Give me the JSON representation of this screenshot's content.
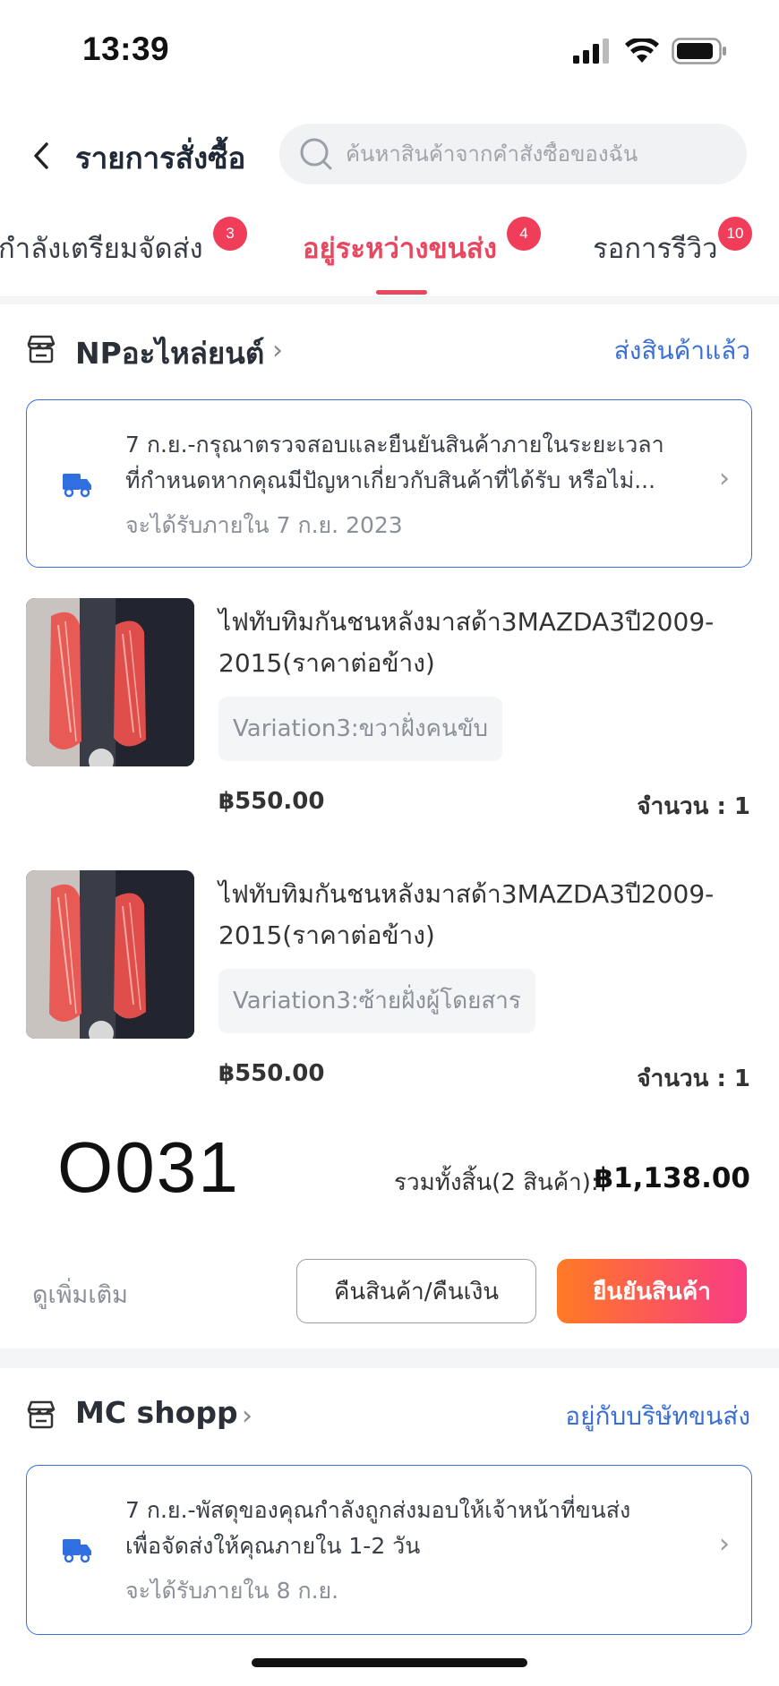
{
  "status_bar": {
    "time": "13:39"
  },
  "header": {
    "title": "รายการสั่งซื้อ",
    "search_placeholder": "ค้นหาสินค้าจากคำสั่งซื้อของฉัน"
  },
  "tabs": [
    {
      "label": "กำลังเตรียมจัดส่ง",
      "badge": "3",
      "active": false
    },
    {
      "label": "อยู่ระหว่างขนส่ง",
      "badge": "4",
      "active": true
    },
    {
      "label": "รอการรีวิว",
      "badge": "10",
      "active": false
    }
  ],
  "colors": {
    "accent": "#e8475f",
    "link": "#3a6fd8",
    "badge": "#ef3d5a"
  },
  "orders": [
    {
      "shop_name": "NPอะไหล่ยนต์",
      "shop_status": "ส่งสินค้าแล้ว",
      "tracking": {
        "line1": "7 ก.ย.-กรุณาตรวจสอบและยืนยันสินค้าภายในระยะเวลา",
        "line2": "ที่กำหนดหากคุณมีปัญหาเกี่ยวกับสินค้าที่ได้รับ หรือไม่...",
        "sub": "จะได้รับภายใน 7 ก.ย. 2023"
      },
      "items": [
        {
          "name": "ไฟทับทิมกันชนหลังมาสด้า3MAZDA3ปี2009-2015(ราคาต่อข้าง)",
          "variation": "Variation3:ขวาฝั่งคนขับ",
          "price": "฿550.00",
          "qty": "จำนวน : 1"
        },
        {
          "name": "ไฟทับทิมกันชนหลังมาสด้า3MAZDA3ปี2009-2015(ราคาต่อข้าง)",
          "variation": "Variation3:ซ้ายฝั่งผู้โดยสาร",
          "price": "฿550.00",
          "qty": "จำนวน : 1"
        }
      ],
      "order_code": "O031",
      "total_label": "รวมทั้งสิ้น(2 สินค้า):",
      "total_value": "฿1,138.00",
      "more_label": "ดูเพิ่มเติม",
      "return_label": "คืนสินค้า/คืนเงิน",
      "confirm_label": "ยืนยันสินค้า"
    },
    {
      "shop_name": "MC shopp",
      "shop_status": "อยู่กับบริษัทขนส่ง",
      "tracking": {
        "line1": "7 ก.ย.-พัสดุของคุณกำลังถูกส่งมอบให้เจ้าหน้าที่ขนส่ง",
        "line2": "เพื่อจัดส่งให้คุณภายใน 1-2  วัน",
        "sub": "จะได้รับภายใน 8 ก.ย."
      }
    }
  ]
}
